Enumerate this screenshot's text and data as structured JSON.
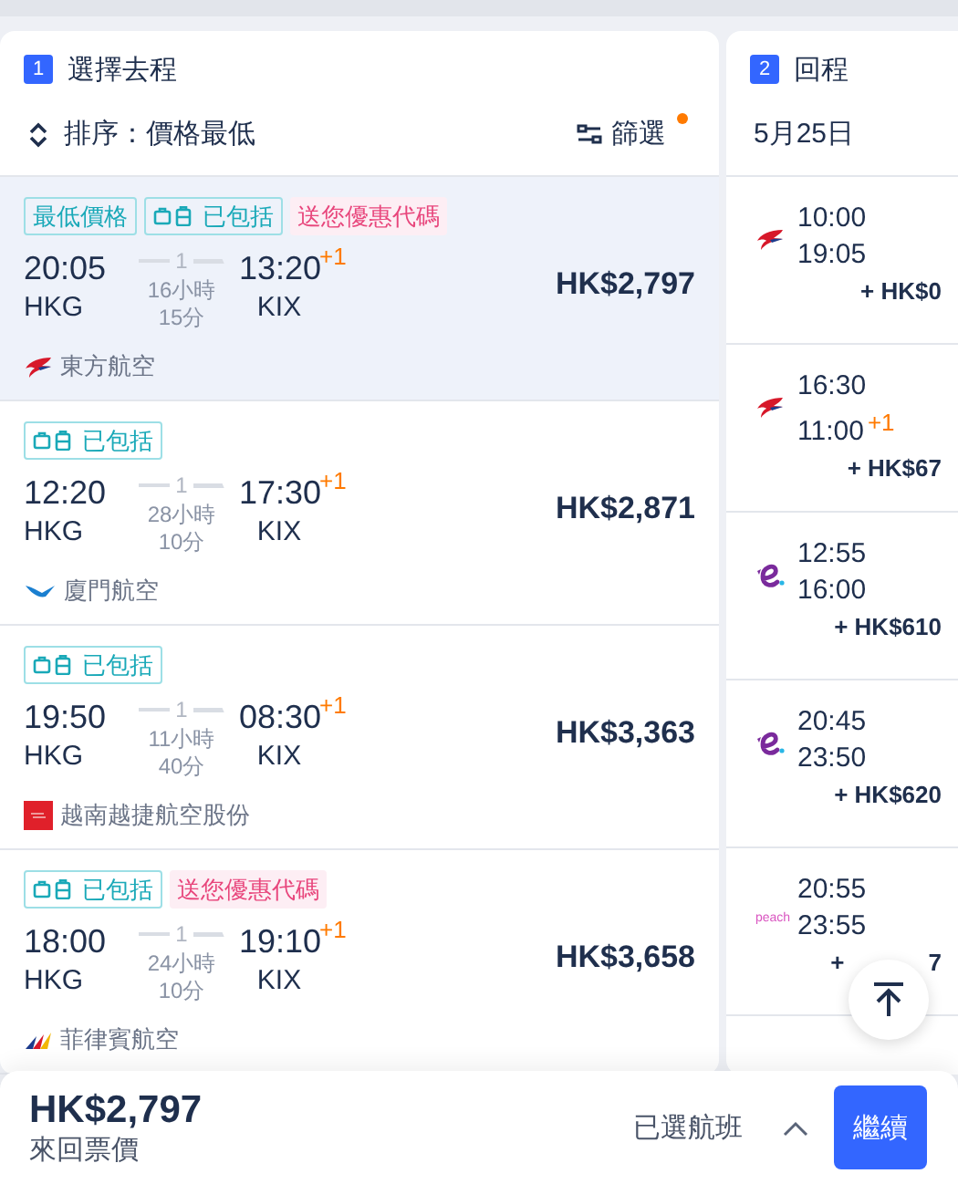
{
  "outbound": {
    "step": "1",
    "title": "選擇去程",
    "sort_label": "排序：價格最低",
    "filter_label": "篩選",
    "filter_active": true,
    "flights": [
      {
        "selected": true,
        "tags": [
          {
            "kind": "lowest",
            "text": "最低價格"
          },
          {
            "kind": "baggage",
            "text": "已包括"
          },
          {
            "kind": "promo",
            "text": "送您優惠代碼"
          }
        ],
        "depart": "20:05",
        "depart_code": "HKG",
        "stops": "1",
        "duration_hours": "16小時",
        "duration_minutes": "15分",
        "arrive": "13:20",
        "arrive_offset": "+1",
        "arrive_code": "KIX",
        "logo": {
          "kind": "swallow"
        },
        "airline": "東方航空",
        "price": "HK$2,797"
      },
      {
        "selected": false,
        "tags": [
          {
            "kind": "baggage",
            "text": "已包括"
          }
        ],
        "depart": "12:20",
        "depart_code": "HKG",
        "stops": "1",
        "duration_hours": "28小時",
        "duration_minutes": "10分",
        "arrive": "17:30",
        "arrive_offset": "+1",
        "arrive_code": "KIX",
        "logo": {
          "kind": "egret"
        },
        "airline": "廈門航空",
        "price": "HK$2,871"
      },
      {
        "selected": false,
        "tags": [
          {
            "kind": "baggage",
            "text": "已包括"
          }
        ],
        "depart": "19:50",
        "depart_code": "HKG",
        "stops": "1",
        "duration_hours": "11小時",
        "duration_minutes": "40分",
        "arrive": "08:30",
        "arrive_offset": "+1",
        "arrive_code": "KIX",
        "logo": {
          "kind": "red-square"
        },
        "airline": "越南越捷航空股份",
        "price": "HK$3,363"
      },
      {
        "selected": false,
        "tags": [
          {
            "kind": "baggage",
            "text": "已包括"
          },
          {
            "kind": "promo",
            "text": "送您優惠代碼"
          }
        ],
        "depart": "18:00",
        "depart_code": "HKG",
        "stops": "1",
        "duration_hours": "24小時",
        "duration_minutes": "10分",
        "arrive": "19:10",
        "arrive_offset": "+1",
        "arrive_code": "KIX",
        "logo": {
          "kind": "stripes"
        },
        "airline": "菲律賓航空",
        "price": "HK$3,658"
      }
    ]
  },
  "return": {
    "step": "2",
    "title": "回程",
    "date": "5月25日",
    "flights": [
      {
        "logo": {
          "kind": "swallow"
        },
        "depart": "10:00",
        "arrive": "19:05",
        "price": "+ HK$0"
      },
      {
        "logo": {
          "kind": "swallow"
        },
        "depart": "16:30",
        "arrive": "11:00",
        "arrive_offset": "+1",
        "price": "+ HK$67"
      },
      {
        "logo": {
          "kind": "e-mark"
        },
        "depart": "12:55",
        "arrive": "16:00",
        "price": "+ HK$610"
      },
      {
        "logo": {
          "kind": "e-mark"
        },
        "depart": "20:45",
        "arrive": "23:50",
        "price": "+ HK$620"
      },
      {
        "logo": {
          "kind": "wordmark",
          "text": "peach"
        },
        "depart": "20:55",
        "arrive": "23:55",
        "price": "+",
        "price_tail": "7"
      }
    ]
  },
  "bottom_bar": {
    "total": "HK$2,797",
    "total_label": "來回票價",
    "selected_label": "已選航班",
    "expanded": false,
    "continue": "繼續"
  }
}
